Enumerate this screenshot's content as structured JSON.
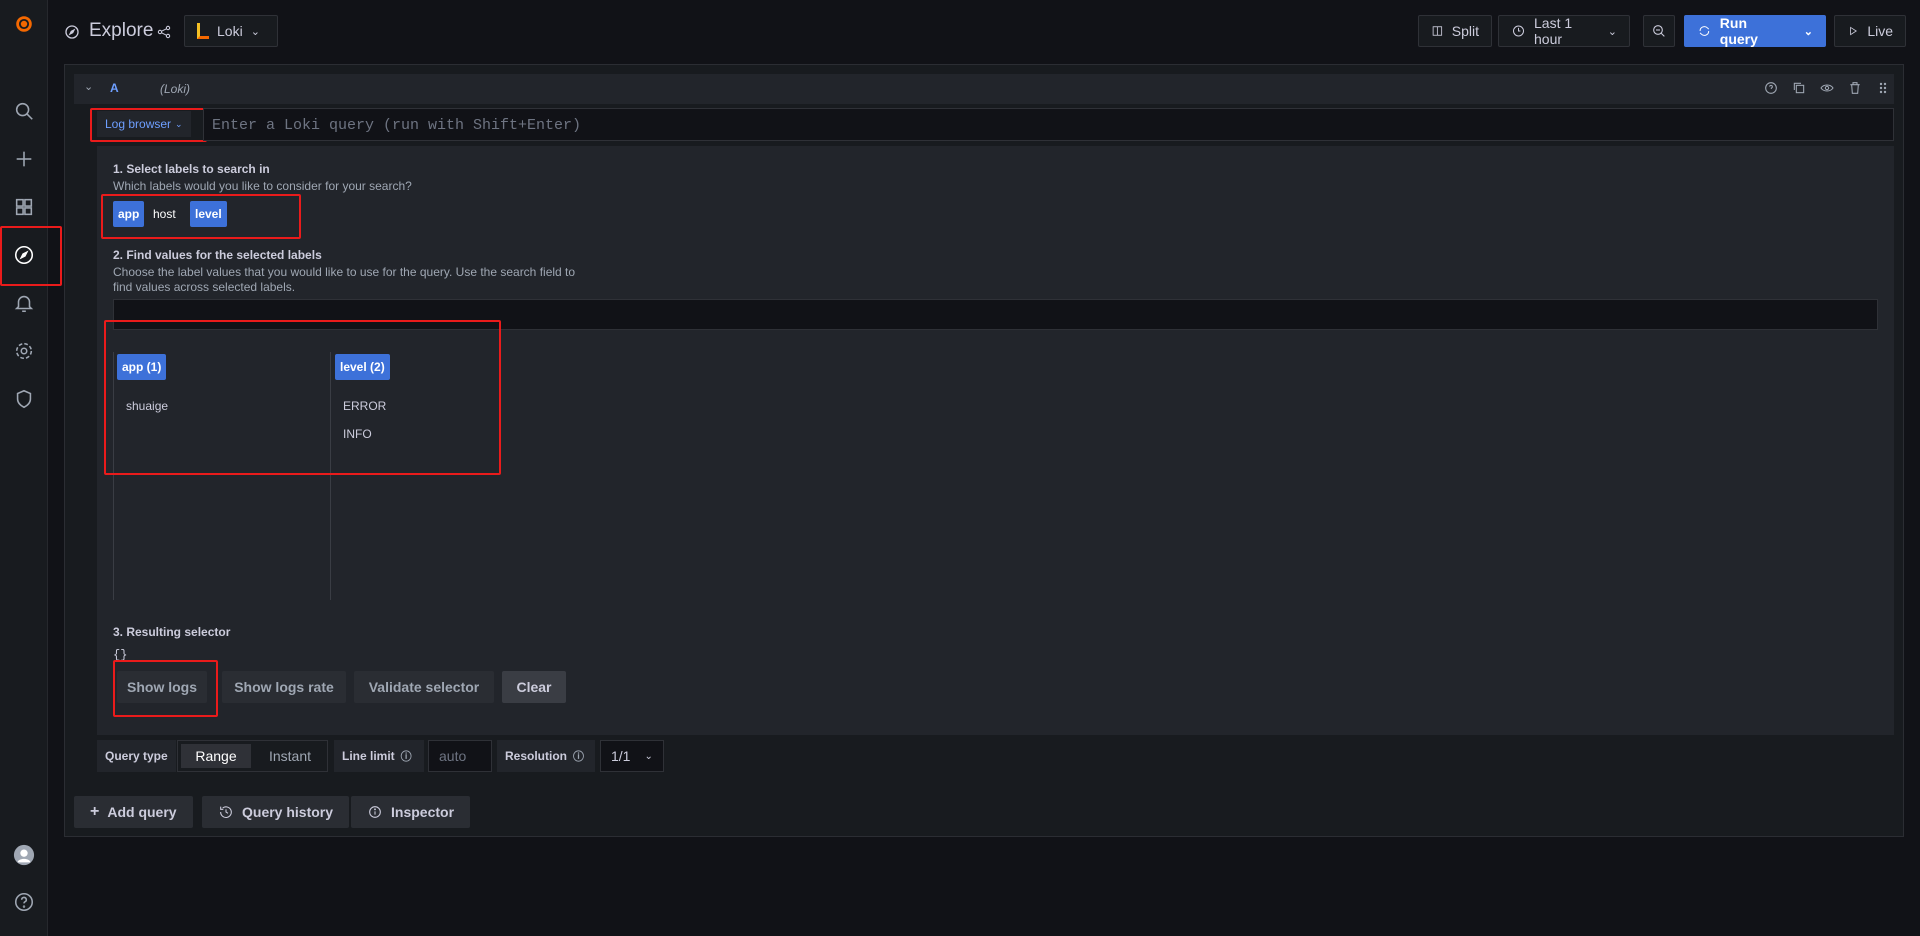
{
  "app": {
    "page_title": "Explore",
    "datasource": "Loki"
  },
  "toolbar": {
    "split_label": "Split",
    "time_range": "Last 1 hour",
    "run_query_label": "Run query",
    "live_label": "Live"
  },
  "query": {
    "ref": "A",
    "datasource_hint": "(Loki)",
    "log_browser_label": "Log browser",
    "placeholder": "Enter a Loki query (run with Shift+Enter)"
  },
  "browser": {
    "step1_title": "1. Select labels to search in",
    "step1_desc": "Which labels would you like to consider for your search?",
    "labels": [
      {
        "name": "app",
        "selected": true
      },
      {
        "name": "host",
        "selected": false
      },
      {
        "name": "level",
        "selected": true
      }
    ],
    "step2_title": "2. Find values for the selected labels",
    "step2_desc_line1": "Choose the label values that you would like to use for the query. Use the search field to",
    "step2_desc_line2": "find values across selected labels.",
    "columns": [
      {
        "header": "app (1)",
        "values": [
          "shuaige"
        ]
      },
      {
        "header": "level (2)",
        "values": [
          "ERROR",
          "INFO"
        ]
      }
    ],
    "step3_title": "3. Resulting selector",
    "selector": "{}",
    "buttons": {
      "show_logs": "Show logs",
      "show_logs_rate": "Show logs rate",
      "validate": "Validate selector",
      "clear": "Clear"
    }
  },
  "options": {
    "query_type_label": "Query type",
    "range": "Range",
    "instant": "Instant",
    "line_limit_label": "Line limit",
    "line_limit_value": "auto",
    "resolution_label": "Resolution",
    "resolution_value": "1/1"
  },
  "footer": {
    "add_query": "Add query",
    "query_history": "Query history",
    "inspector": "Inspector"
  },
  "colors": {
    "accent": "#3d71d9",
    "highlight": "#ea1b1b",
    "bg": "#111217",
    "panel": "#181b1f"
  }
}
